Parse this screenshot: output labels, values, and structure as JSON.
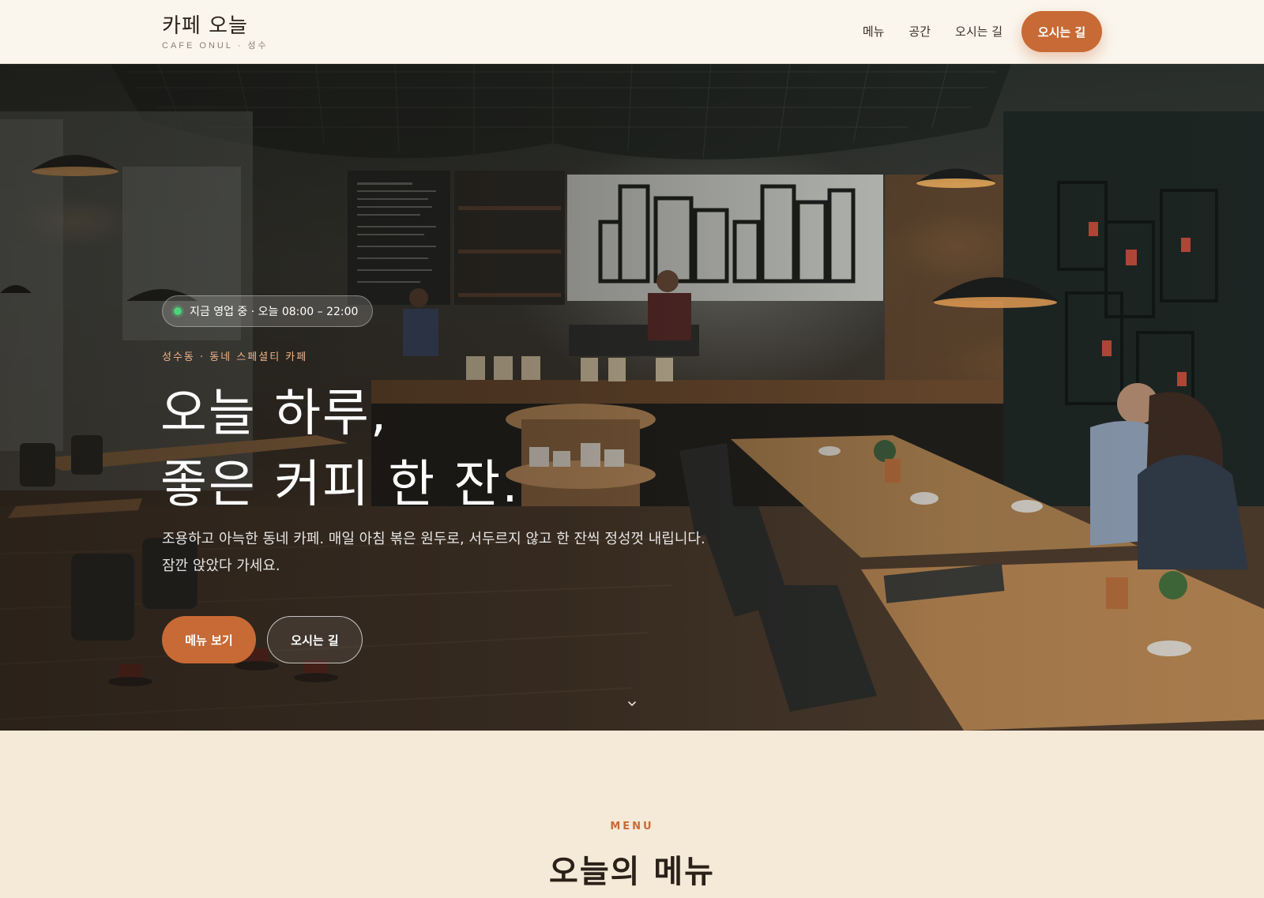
{
  "header": {
    "logo_title": "카페 오늘",
    "logo_sub": "CAFE ONUL · 성수",
    "nav": [
      {
        "label": "메뉴"
      },
      {
        "label": "공간"
      },
      {
        "label": "오시는 길"
      }
    ],
    "cta_label": "오시는 길"
  },
  "hero": {
    "status_badge": "지금 영업 중 · 오늘 08:00 – 22:00",
    "eyebrow": "성수동 · 동네 스페셜티 카페",
    "headline_line1": "오늘 하루,",
    "headline_line2": "좋은 커피 한 잔.",
    "description": "조용하고 아늑한 동네 카페. 매일 아침 볶은 원두로, 서두르지 않고 한 잔씩 정성껏 내립니다. 잠깐 앉았다 가세요.",
    "primary_button": "메뉴 보기",
    "secondary_button": "오시는 길",
    "scroll_icon": "chevron-down-icon"
  },
  "menu_section": {
    "eyebrow": "MENU",
    "title": "오늘의 메뉴"
  },
  "colors": {
    "accent": "#c86a35",
    "header_bg": "#faf6ee",
    "section_bg": "#f5e9d8",
    "open_status": "#4cd47a"
  }
}
